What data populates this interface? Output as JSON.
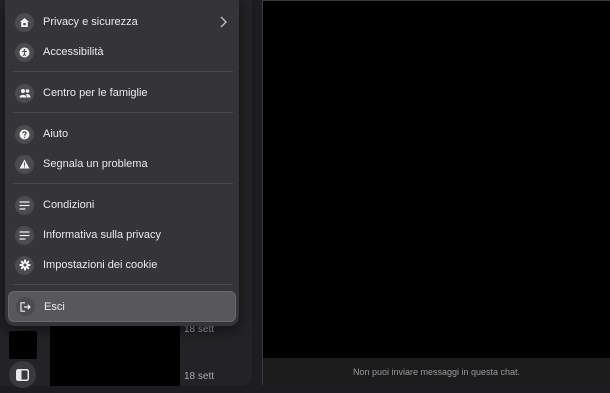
{
  "menu": {
    "items": [
      {
        "label": "Privacy e sicurezza",
        "icon": "home-lock-icon",
        "has_submenu": true
      },
      {
        "label": "Accessibilità",
        "icon": "accessibility-icon"
      },
      {
        "label": "Centro per le famiglie",
        "icon": "people-icon"
      },
      {
        "label": "Aiuto",
        "icon": "help-icon"
      },
      {
        "label": "Segnala un problema",
        "icon": "warning-icon"
      },
      {
        "label": "Condizioni",
        "icon": "lines-icon"
      },
      {
        "label": "Informativa sulla privacy",
        "icon": "lines-icon"
      },
      {
        "label": "Impostazioni dei cookie",
        "icon": "gear-icon"
      },
      {
        "label": "Esci",
        "icon": "logout-icon"
      }
    ]
  },
  "chat_list": {
    "dates": [
      "18 sett",
      "18 sett"
    ]
  },
  "conversation": {
    "notice": "Non puoi inviare messaggi in questa chat."
  }
}
